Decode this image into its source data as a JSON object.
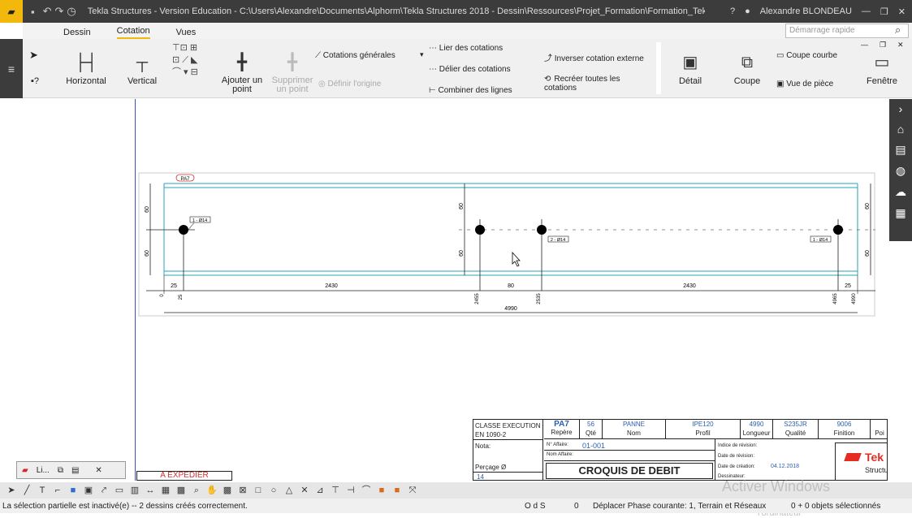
{
  "titlebar": {
    "title": "Tekla Structures - Version Education - C:\\Users\\Alexandre\\Documents\\Alphorm\\Tekla Structures 2018 - Dessin\\Ressources\\Projet_Formation\\Formation_Tekla_D...",
    "help": "?",
    "user": "Alexandre BLONDEAU"
  },
  "tabs": [
    "Dessin",
    "Cotation",
    "Vues"
  ],
  "search_placeholder": "Démarrage rapide",
  "ribbon": {
    "horizontal": "Horizontal",
    "vertical": "Vertical",
    "ajouter_point": "Ajouter un point",
    "supprimer_point": "Supprimer un point",
    "definir_origine": "Définir l'origine",
    "cotations_generales": "Cotations générales",
    "lier": "Lier des cotations",
    "delier": "Délier des cotations",
    "combiner": "Combiner des lignes",
    "inverser": "Inverser cotation externe",
    "recreer": "Recréer toutes les cotations",
    "detail": "Détail",
    "coupe": "Coupe",
    "coupe_courbe": "Coupe courbe",
    "vue_piece": "Vue de pièce",
    "fenetre": "Fenêtre"
  },
  "drawing": {
    "part_label": "PA7",
    "hole_labels": [
      "1 - Ø14",
      "2 - Ø14",
      "1 - Ø14"
    ],
    "left_vertical_dims": [
      "60",
      "60"
    ],
    "mid_vertical_dims": [
      "60",
      "60"
    ],
    "right_vertical_dims": [
      "60",
      "60"
    ],
    "bottom_chain": [
      "25",
      "2430",
      "80",
      "2430",
      "25"
    ],
    "ordinates": [
      "0",
      "25",
      "2455",
      "2535",
      "4965",
      "4990"
    ],
    "overall": "4990"
  },
  "cartouche": {
    "classe": "CLASSE EXECUTION",
    "norme": "EN 1090-2",
    "nota": "Nota:",
    "percage": "Perçage Ø",
    "percage_val": "14",
    "repere_val": "PA7",
    "qte_val": "56",
    "nom_val": "PANNE",
    "profil_val": "IPE120",
    "longueur_val": "4990",
    "qualite_val": "S235JR",
    "finition_val": "9006",
    "repere": "Repère",
    "qte": "Qté",
    "nom": "Nom",
    "profil": "Profil",
    "longueur": "Longueur",
    "qualite": "Qualité",
    "finition": "Finition",
    "poids": "Poi",
    "n_affaire": "N° Affaire:",
    "n_affaire_val": "01-001",
    "nom_affaire": "Nom Affaire:",
    "indice": "Indice de révision:",
    "date_rev": "Date de révision:",
    "date_creation": "Date de création:",
    "date_creation_val": "04.12.2018",
    "dessinateur": "Dessinateur:",
    "croquis": "CROQUIS  DE  DEBIT",
    "logo": "Tek",
    "logo2": "Structu"
  },
  "left_panel": {
    "tab": "Li..."
  },
  "expedier": "A EXPEDIER",
  "watermark": {
    "line1": "Activer Windows",
    "line2": "Accédez aux paramètres de l'ordinateur"
  },
  "status": {
    "left": "La sélection partielle est inactivé(e) -- 2 dessins créés correctement.",
    "ods": "O d S",
    "zero": "0",
    "phase": "Déplacer Phase courante: 1, Terrain et Réseaux",
    "sel": "0 + 0 objets sélectionnés"
  }
}
